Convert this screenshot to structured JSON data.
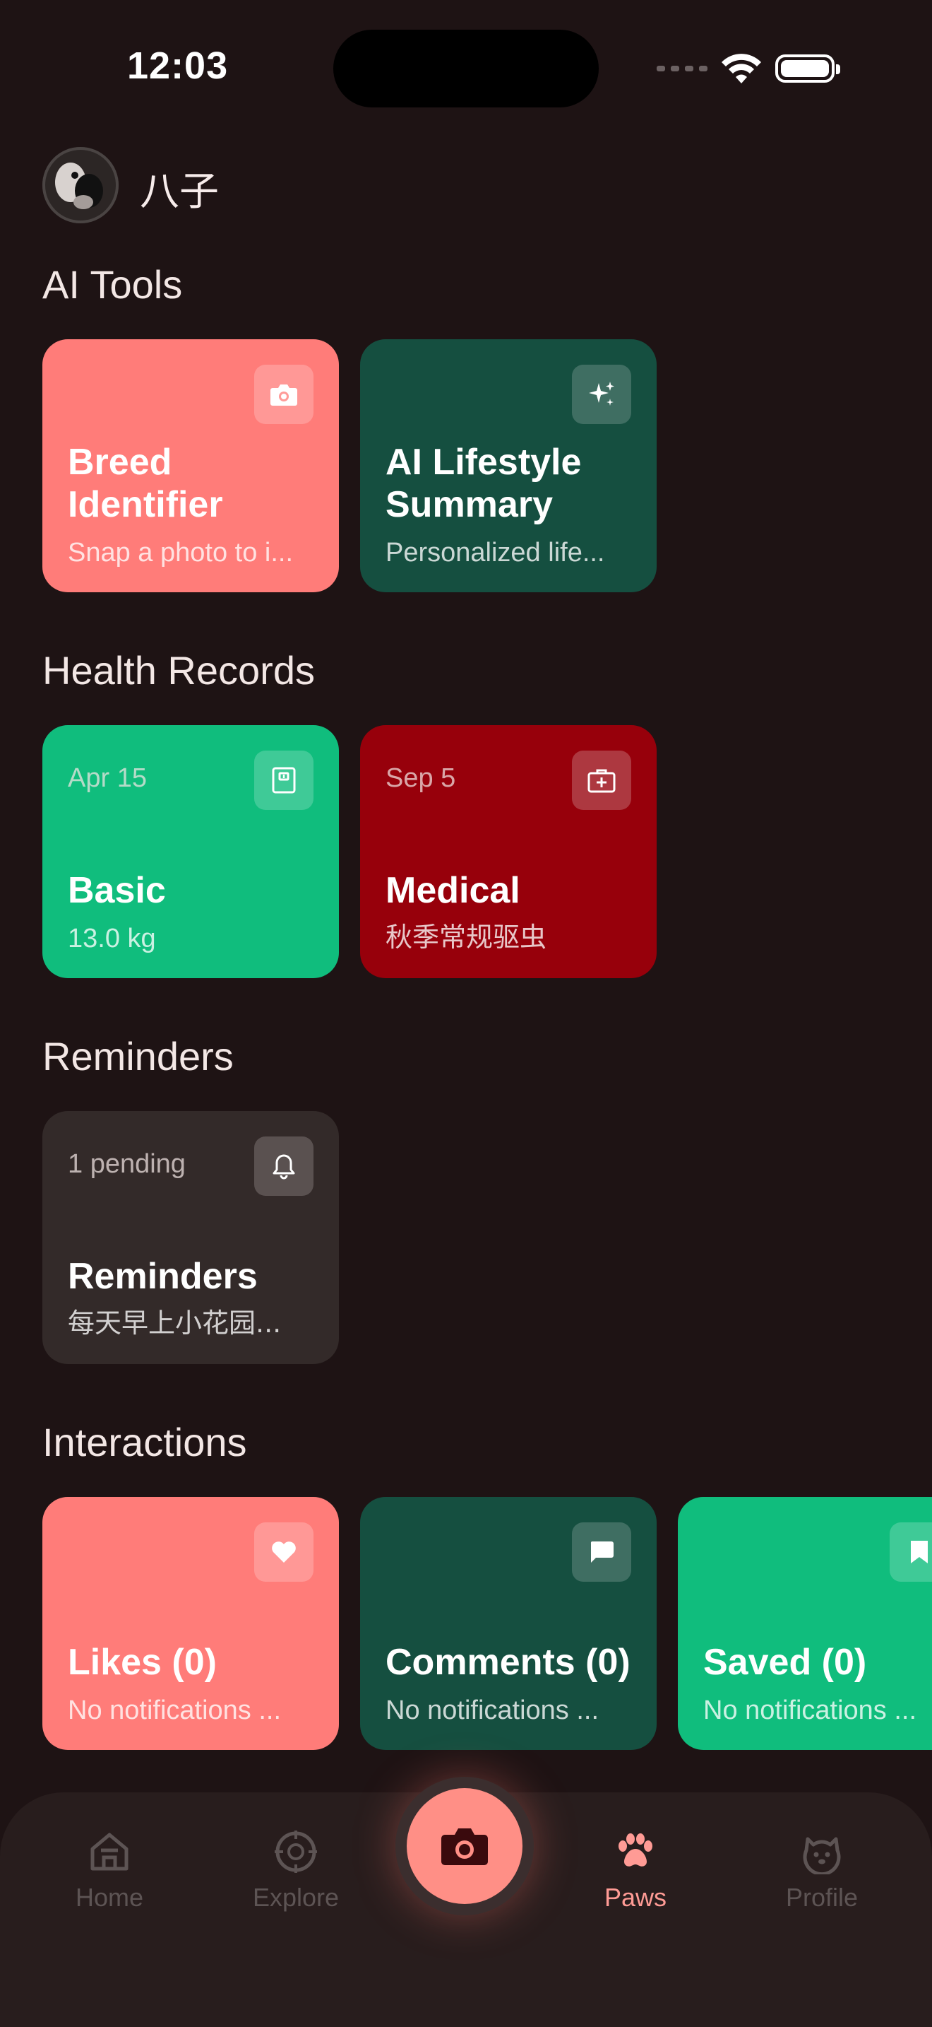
{
  "status": {
    "time": "12:03"
  },
  "header": {
    "pet_name": "八子"
  },
  "sections": {
    "ai_tools": {
      "title": "AI Tools",
      "cards": [
        {
          "title": "Breed Identifier",
          "subtitle": "Snap a photo to i...",
          "icon": "camera-icon",
          "color": "#ff7c79"
        },
        {
          "title": "AI Lifestyle Summary",
          "subtitle": "Personalized life...",
          "icon": "sparkles-icon",
          "color": "#154f40"
        }
      ]
    },
    "health_records": {
      "title": "Health Records",
      "cards": [
        {
          "meta": "Apr 15",
          "title": "Basic",
          "subtitle": "13.0 kg",
          "icon": "scale-icon",
          "color": "#10bd7d"
        },
        {
          "meta": "Sep 5",
          "title": "Medical",
          "subtitle": "秋季常规驱虫",
          "icon": "medical-kit-icon",
          "color": "#97000b"
        }
      ]
    },
    "reminders": {
      "title": "Reminders",
      "cards": [
        {
          "meta": "1 pending",
          "title": "Reminders",
          "subtitle": "每天早上小花园...",
          "icon": "bell-icon",
          "color": "#332a29"
        }
      ]
    },
    "interactions": {
      "title": "Interactions",
      "cards": [
        {
          "title": "Likes (0)",
          "subtitle": "No notifications ...",
          "icon": "heart-icon",
          "color": "#ff7c79"
        },
        {
          "title": "Comments (0)",
          "subtitle": "No notifications ...",
          "icon": "comment-icon",
          "color": "#154f40"
        },
        {
          "title": "Saved (0)",
          "subtitle": "No notifications ...",
          "icon": "bookmark-icon",
          "color": "#10bd7d"
        }
      ]
    }
  },
  "nav": {
    "items": [
      {
        "label": "Home",
        "icon": "home-icon",
        "active": false
      },
      {
        "label": "Explore",
        "icon": "compass-icon",
        "active": false
      },
      {
        "label": "",
        "icon": "camera-icon",
        "active": false
      },
      {
        "label": "Paws",
        "icon": "paw-icon",
        "active": true
      },
      {
        "label": "Profile",
        "icon": "dog-face-icon",
        "active": false
      }
    ],
    "active_color": "#ff9b95"
  }
}
